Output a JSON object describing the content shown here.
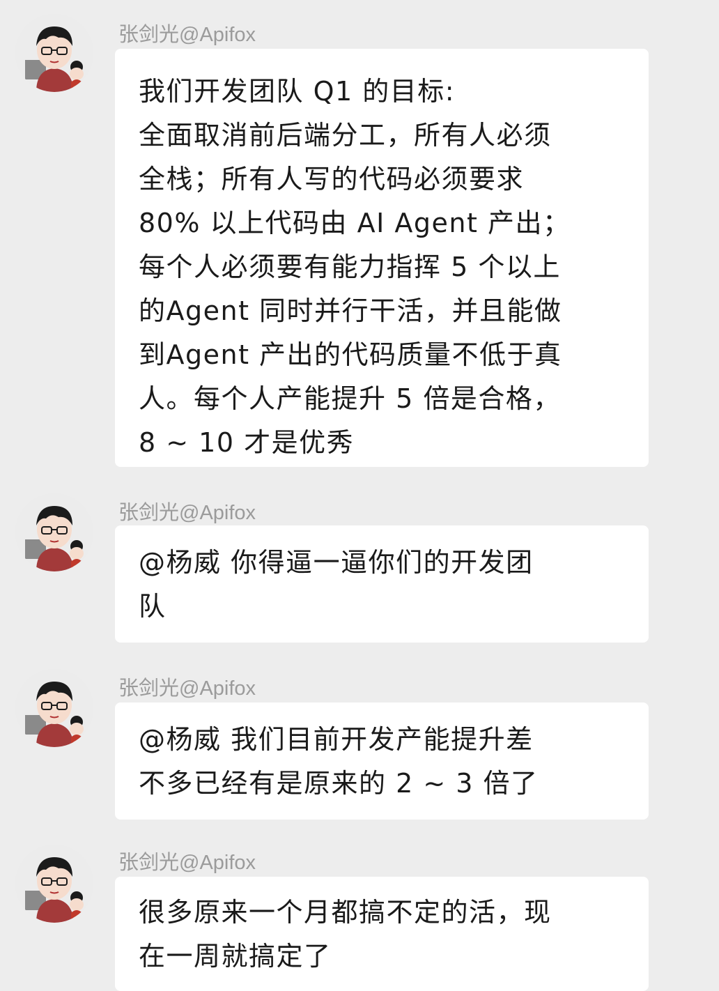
{
  "messages": [
    {
      "sender": "张剑光@Apifox",
      "lines": [
        "我们开发团队 Q1 的目标:",
        "全面取消前后端分工，所有人必须",
        "全栈；所有人写的代码必须要求",
        "80% 以上代码由 AI Agent 产出；",
        "每个人必须要有能力指挥 5 个以上",
        "的Agent 同时并行干活，并且能做",
        "到Agent 产出的代码质量不低于真",
        "人。每个人产能提升 5 倍是合格，",
        "8 ~ 10 才是优秀"
      ]
    },
    {
      "sender": "张剑光@Apifox",
      "lines": [
        "@杨威  你得逼一逼你们的开发团",
        "队"
      ]
    },
    {
      "sender": "张剑光@Apifox",
      "lines": [
        "@杨威  我们目前开发产能提升差",
        "不多已经有是原来的 2 ~ 3 倍了"
      ]
    },
    {
      "sender": "张剑光@Apifox",
      "lines": [
        "很多原来一个月都搞不定的活，现",
        "在一周就搞定了"
      ]
    }
  ],
  "avatar_icon": "cartoon-boy-with-glasses-avatar"
}
